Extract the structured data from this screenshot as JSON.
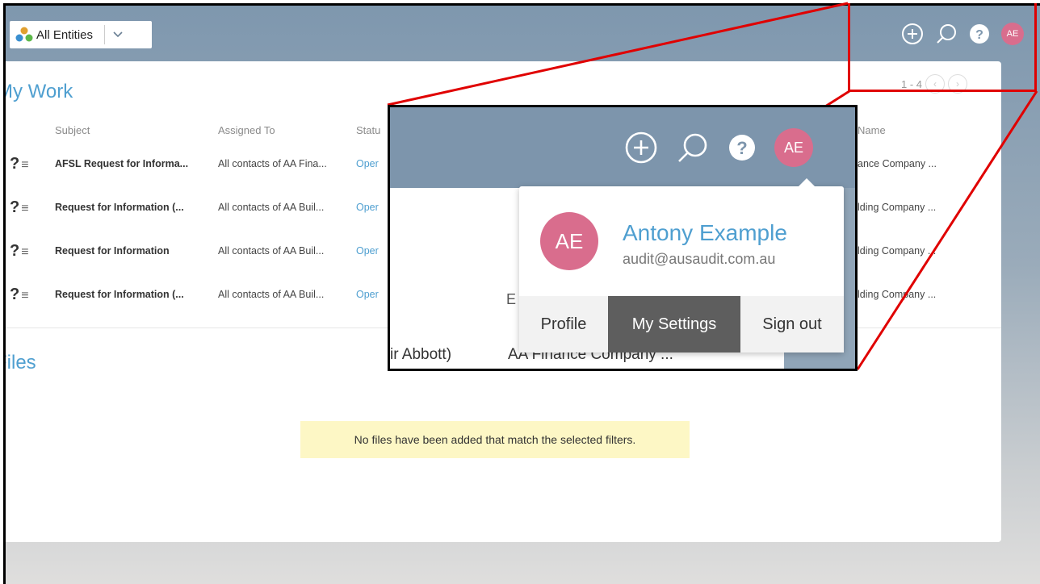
{
  "header": {
    "entity_label": "All Entities",
    "avatar_initials": "AE",
    "colors": {
      "header": "#7e97ae",
      "accent": "#4f9fd0",
      "avatar": "#d96d8d"
    },
    "icons": [
      "entities-icon",
      "chevron-down-icon",
      "add-icon",
      "search-icon",
      "help-icon"
    ]
  },
  "my_work": {
    "title": "My Work",
    "pager_text": "1 - 4",
    "columns": {
      "subject": "Subject",
      "assigned": "Assigned To",
      "status": "Statu",
      "name": "Name"
    },
    "rows": [
      {
        "icon": "?",
        "subject": "AFSL Request for Informa...",
        "assigned": "All contacts of AA Fina...",
        "status": "Oper",
        "name": "ance Company ..."
      },
      {
        "icon": "?",
        "subject": "Request for Information (...",
        "assigned": "All contacts of AA Buil...",
        "status": "Oper",
        "name": "lding Company ..."
      },
      {
        "icon": "?",
        "subject": "Request for Information",
        "assigned": "All contacts of AA Buil...",
        "status": "Oper",
        "name": "lding Company ..."
      },
      {
        "icon": "?",
        "subject": "Request for Information (...",
        "assigned": "All contacts of AA Buil...",
        "status": "Oper",
        "name": "lding Company ..."
      }
    ]
  },
  "files": {
    "title": "Files",
    "empty_message": "No files have been added that match the selected filters."
  },
  "zoom": {
    "avatar_initials": "AE",
    "bg_e": "E",
    "bg_left": "ir Abbott)",
    "bg_right": "AA Finance Company ...",
    "dropdown": {
      "avatar_initials": "AE",
      "name": "Antony Example",
      "email": "audit@ausaudit.com.au",
      "profile": "Profile",
      "settings": "My Settings",
      "signout": "Sign out"
    }
  }
}
